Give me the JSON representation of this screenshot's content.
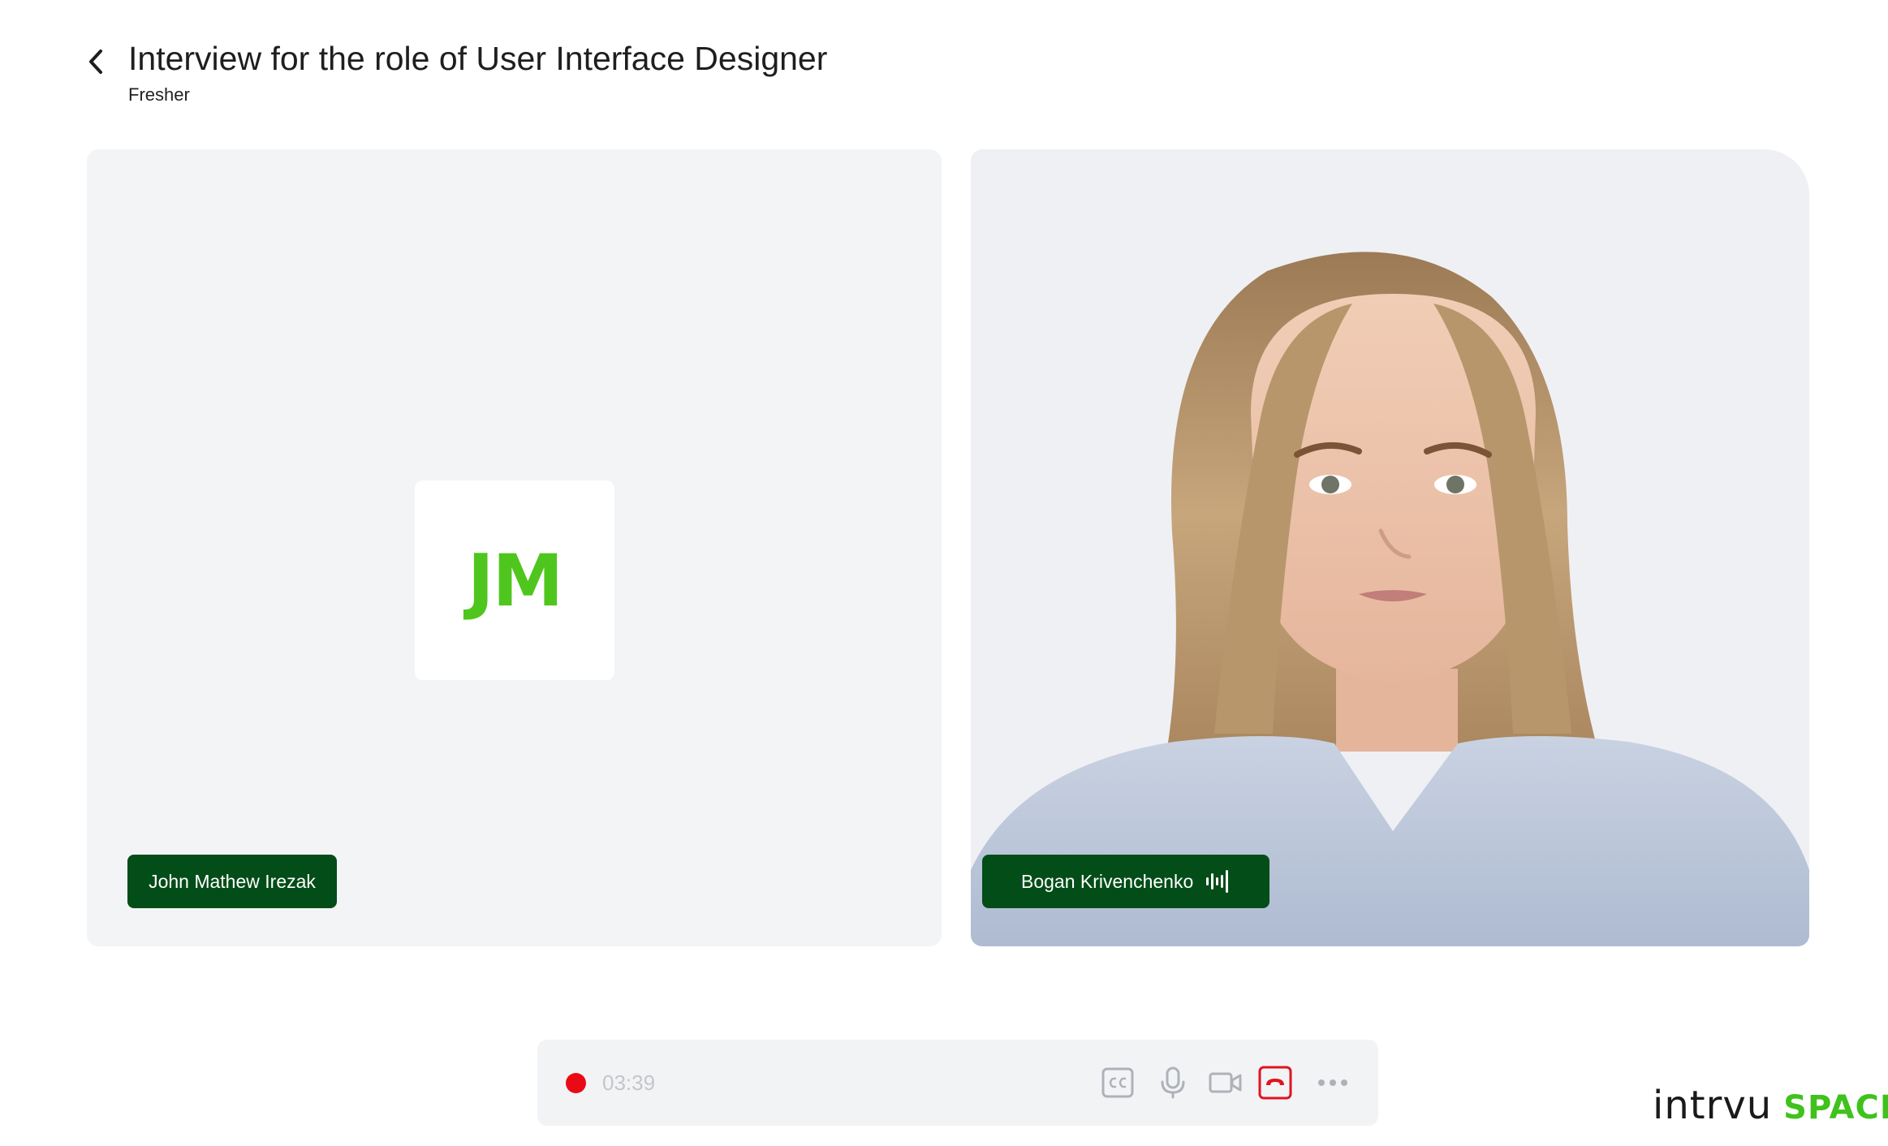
{
  "header": {
    "title": "Interview for the role of User Interface Designer",
    "subtitle": "Fresher"
  },
  "participants": {
    "left": {
      "name": "John Mathew Irezak",
      "initials": "JM"
    },
    "right": {
      "name": "Bogan Krivenchenko"
    }
  },
  "call": {
    "timer": "03:39",
    "recording": true
  },
  "brand": {
    "word": "intrvu",
    "accent": "SPACE"
  },
  "colors": {
    "accent_green": "#4fc61d",
    "name_tag": "#034d18",
    "record_red": "#ea0a16",
    "end_call_red": "#e01420"
  },
  "icons": [
    "back-arrow-icon",
    "audio-wave-icon",
    "record-icon",
    "captions-icon",
    "microphone-icon",
    "video-camera-icon",
    "end-call-icon",
    "more-icon"
  ]
}
